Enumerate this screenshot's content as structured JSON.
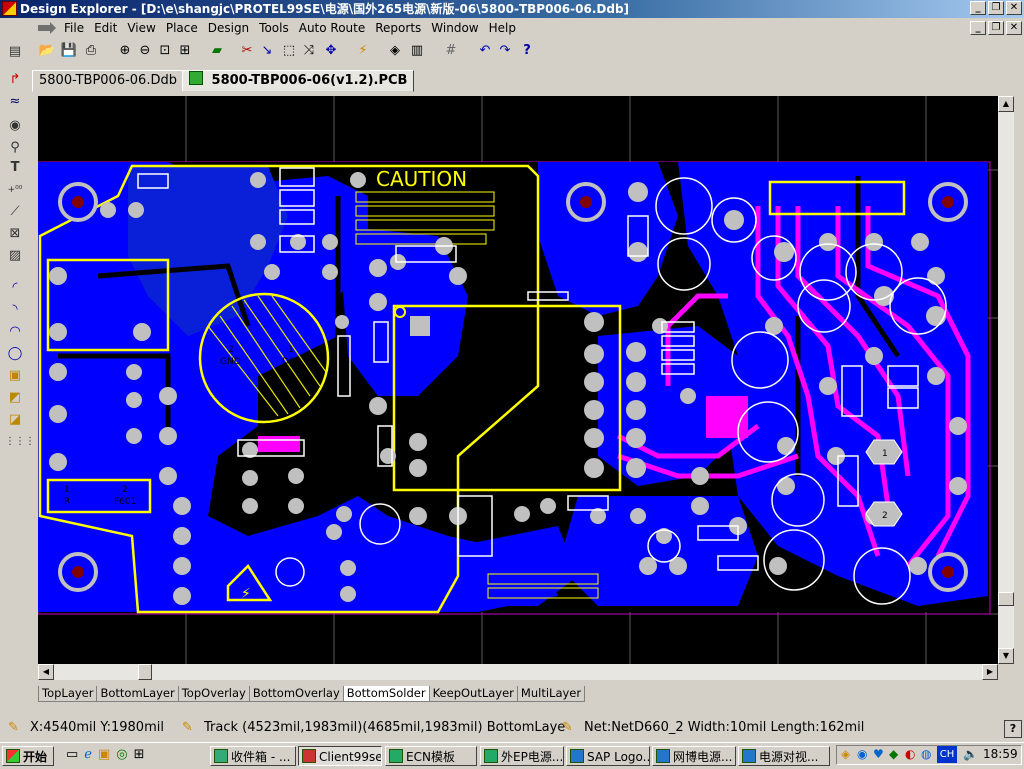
{
  "window": {
    "title": "Design Explorer - [D:\\e\\shangjc\\PROTEL99SE\\电源\\国外265电源\\新版-06\\5800-TBP006-06.Ddb]"
  },
  "menu": [
    "File",
    "Edit",
    "View",
    "Place",
    "Design",
    "Tools",
    "Auto Route",
    "Reports",
    "Window",
    "Help"
  ],
  "toolbar_icons": [
    "folder-open-icon",
    "save-icon",
    "print-icon",
    "zoom-in-icon",
    "zoom-out-icon",
    "zoom-fit-icon",
    "zoom-area-icon",
    "3d-view-icon",
    "cut-icon",
    "route-icon",
    "select-area-icon",
    "deselect-icon",
    "move-icon",
    "interactive-route-icon",
    "layer-stack-icon",
    "component-icon",
    "grid-icon",
    "undo-icon",
    "redo-icon",
    "help-icon"
  ],
  "tabs": [
    {
      "label": "5800-TBP006-06.Ddb",
      "active": false
    },
    {
      "label": "5800-TBP006-06(v1.2).PCB",
      "active": true
    }
  ],
  "pcb": {
    "caution_label": "CAUTION",
    "pad_labels": [
      "2",
      "GND",
      "1",
      "D60",
      "1",
      "R",
      "2",
      "F601",
      "1",
      "2"
    ]
  },
  "layer_tabs": [
    "TopLayer",
    "BottomLayer",
    "TopOverlay",
    "BottomOverlay",
    "BottomSolder",
    "KeepOutLayer",
    "MultiLayer"
  ],
  "active_layer_tab": "BottomSolder",
  "status": {
    "coords": "X:4540mil Y:1980mil",
    "track": "Track (4523mil,1983mil)(4685mil,1983mil)  BottomLaye",
    "net": "Net:NetD660_2 Width:10mil Length:162mil"
  },
  "taskbar": {
    "start_label": "开始",
    "items": [
      "收件箱 - ...",
      "Client99se",
      "ECN模板",
      "外EP电源...",
      "SAP Logo...",
      "网博电源...",
      "电源对视..."
    ],
    "active_index": 1,
    "clock": "18:59",
    "lang": "CH"
  },
  "colors": {
    "board": "#0000ff",
    "silkscreen": "#ffff00",
    "pads": "#c0c0c0",
    "toplayer": "#ff00ff",
    "background": "#000000"
  }
}
